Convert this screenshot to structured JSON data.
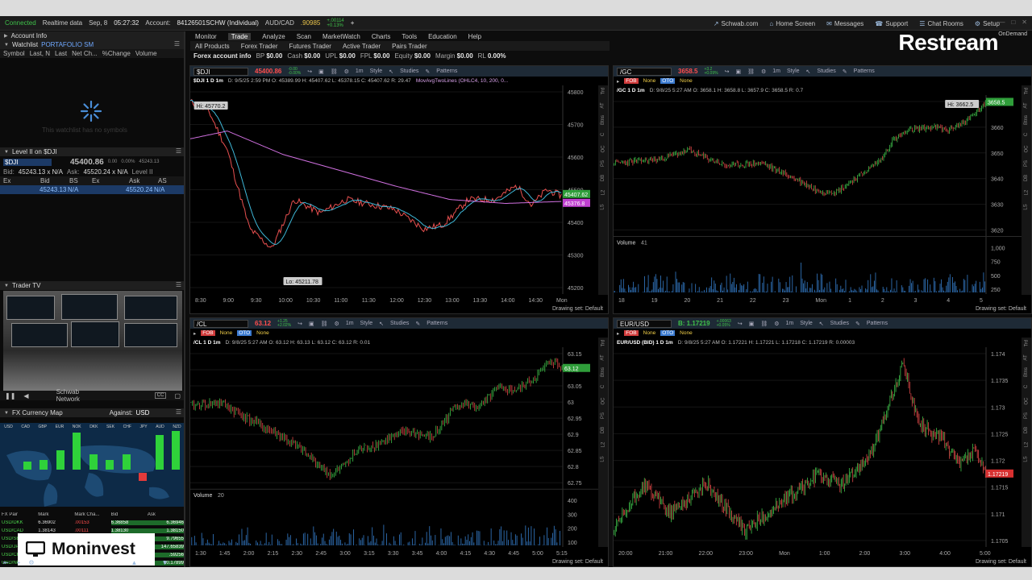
{
  "topbar": {
    "status": "Connected",
    "feed": "Realtime data",
    "date": "Sep, 8",
    "time": "05:27:32",
    "account_label": "Account:",
    "account_id": "84126501SCHW (Individual)",
    "pair": "AUD/CAD",
    "pair_price": ".90985",
    "pair_change": "+.00114",
    "pair_change2": "+0.13%",
    "add": "+",
    "links": [
      "Schwab.com",
      "Home Screen",
      "Messages",
      "Support",
      "Chat Rooms",
      "Setup"
    ]
  },
  "overlay": {
    "restream": "Restream",
    "ondemand": "OnDemand",
    "moninvest": "Moninvest"
  },
  "nav": {
    "tabs": [
      "Monitor",
      "Trade",
      "Analyze",
      "Scan",
      "MarketWatch",
      "Charts",
      "Tools",
      "Education",
      "Help"
    ],
    "active": "Trade",
    "sub": [
      "All Products",
      "Forex Trader",
      "Futures Trader",
      "Active Trader",
      "Pairs Trader"
    ],
    "acct_title": "Forex account info",
    "acct": [
      {
        "k": "BP",
        "v": "$0.00"
      },
      {
        "k": "Cash",
        "v": "$0.00"
      },
      {
        "k": "UPL",
        "v": "$0.00"
      },
      {
        "k": "FPL",
        "v": "$0.00"
      },
      {
        "k": "Equity",
        "v": "$0.00"
      },
      {
        "k": "Margin",
        "v": "$0.00"
      },
      {
        "k": "RL",
        "v": "0.00%"
      }
    ]
  },
  "left": {
    "account_info": "Account Info",
    "watchlist": "Watchlist",
    "watchlist_name": "PORTAFOLIO SM",
    "watchlist_cols": [
      "Symbol",
      "Last, N",
      "Last",
      "Net Ch...",
      "%Change",
      "Volume"
    ],
    "watchlist_empty": "This watchlist has no symbols",
    "level2_title": "Level II on $DJI",
    "level2_sym": "$DJI",
    "level2_price": "45400.86",
    "level2_chg": "0.00",
    "level2_pct": "0.00%",
    "level2_hi": "45243.13",
    "level2_lo": "45520.24",
    "level2_bidask": [
      "Bid:",
      "45243.13 x N/A",
      "Ask:",
      "45520.24 x N/A",
      "Level II"
    ],
    "level2_cols": [
      "Ex",
      "Bid",
      "BS",
      "Ex",
      "Ask",
      "AS"
    ],
    "level2_row": [
      "",
      "45243.13",
      "N/A",
      "",
      "45520.24",
      "N/A"
    ],
    "trader_tv": "Trader TV",
    "network": "Schwab Network",
    "cc": "CC",
    "fx_title": "FX Currency Map",
    "fx_against": "Against:",
    "fx_base": "USD",
    "fx_currencies": [
      "USD",
      "CAD",
      "GBP",
      "EUR",
      "NOK",
      "DKK",
      "SEK",
      "CHF",
      "JPY",
      "AUD",
      "NZD"
    ],
    "fx_cols": [
      "FX Pair",
      "Mark",
      "Mark Cha...",
      "Bid",
      "Ask"
    ],
    "fx_rows": [
      [
        "USD/DKK",
        "6.36902",
        ".00153",
        "6.36858",
        "6.36946"
      ],
      [
        "USD/CAD",
        "1.38143",
        ".00111",
        "1.38130",
        "1.38150"
      ],
      [
        "USD/SEK",
        "",
        "",
        "",
        "9.79655"
      ],
      [
        "USD/JPY",
        "",
        "",
        "",
        "147.65839"
      ],
      [
        "USD/CHF",
        "",
        "",
        "",
        ".59256"
      ],
      [
        "USD/NOK",
        "",
        "",
        "",
        "10.17899"
      ]
    ]
  },
  "charts": [
    {
      "id": "dji",
      "symbol": "$DJI",
      "price": "45400.86",
      "price_color": "#ff4d4d",
      "change": "-0.00",
      "change_pct": "-0.00%",
      "title": "$DJI 1 D 1m",
      "info": "D: 9/5/25 2:59 PM  O: 45389.99  H: 45407.62  L: 45378.15  C: 45407.62  R: 29.47",
      "study": "MovAvgTwoLines (OHLC4, 10, 200, 0...",
      "hi_label": "Hi: 45770.2",
      "lo_label": "Lo: 45211.78",
      "price_tag": "45407.62",
      "ma_tag": "45376.8",
      "yticks": [
        "45800",
        "45700",
        "45600",
        "45500",
        "45400",
        "45300",
        "45200"
      ],
      "xticks": [
        "8:30",
        "9:00",
        "9:30",
        "10:00",
        "10:30",
        "11:00",
        "11:30",
        "12:00",
        "12:30",
        "13:00",
        "13:30",
        "14:00",
        "14:30",
        "Mon"
      ],
      "drawing": "Drawing set: Default"
    },
    {
      "id": "gc",
      "symbol": "/GC",
      "price": "3658.5",
      "price_color": "#ff4d4d",
      "change": "+3.2",
      "change_pct": "+0.09%",
      "title": "/GC 1 D 1m",
      "info": "D: 9/8/25 5:27 AM  O: 3658.1  H: 3658.8  L: 3657.9  C: 3658.5  R: 0.7",
      "hi_label": "Hi: 3662.5",
      "price_tag": "3658.5",
      "yticks": [
        "3670",
        "3660",
        "3650",
        "3640",
        "3630",
        "3620"
      ],
      "volume_label": "Volume",
      "volume_val": "41",
      "vticks": [
        "1,000",
        "750",
        "500",
        "250"
      ],
      "xticks": [
        "18",
        "19",
        "20",
        "21",
        "22",
        "23",
        "Mon",
        "1",
        "2",
        "3",
        "4",
        "5"
      ],
      "drawing": "Drawing set: Default"
    },
    {
      "id": "cl",
      "symbol": "/CL",
      "price": "63.12",
      "price_color": "#ff4d4d",
      "change": "+1.25",
      "change_pct": "+2.02%",
      "title": "/CL 1 D 1m",
      "info": "D: 9/8/25 5:27 AM  O: 63.12  H: 63.13  L: 63.12  C: 63.12  R: 0.01",
      "price_tag": "63.12",
      "yticks": [
        "63.15",
        "63.1",
        "63.05",
        "63",
        "62.95",
        "62.9",
        "62.85",
        "62.8",
        "62.75"
      ],
      "volume_label": "Volume",
      "volume_val": "20",
      "vticks": [
        "400",
        "300",
        "200",
        "100"
      ],
      "xticks": [
        "1:30",
        "1:45",
        "2:00",
        "2:15",
        "2:30",
        "2:45",
        "3:00",
        "3:15",
        "3:30",
        "3:45",
        "4:00",
        "4:15",
        "4:30",
        "4:45",
        "5:00",
        "5:15"
      ],
      "drawing": "Drawing set: Default"
    },
    {
      "id": "eur",
      "symbol": "EUR/USD",
      "price": "B: 1.17219",
      "price_color": "#3fc14a",
      "change": "+.00063",
      "change_pct": "+0.05%",
      "title": "EUR/USD (BID) 1 D 1m",
      "info": "D: 9/8/25 5:27 AM  O: 1.17221  H: 1.17221  L: 1.17218  C: 1.17219  R: 0.00003",
      "price_tag": "1.17219",
      "yticks": [
        "1.174",
        "1.1735",
        "1.173",
        "1.1725",
        "1.172",
        "1.1715",
        "1.171",
        "1.1705"
      ],
      "xticks": [
        "20:00",
        "21:00",
        "22:00",
        "23:00",
        "Mon",
        "1:00",
        "2:00",
        "3:00",
        "4:00",
        "5:00"
      ],
      "drawing": "Drawing set: Default"
    }
  ],
  "toolbar": {
    "style": "Style",
    "studies": "Studies",
    "patterns": "Patterns",
    "interval": "1m",
    "fob": "FOB",
    "none": "None",
    "oto": "OTO"
  },
  "colors": {
    "up": "#3fc14a",
    "down": "#e04848",
    "accent": "#6fa8ff",
    "volume": "#2f6fb4",
    "ma": "#d070e0"
  }
}
